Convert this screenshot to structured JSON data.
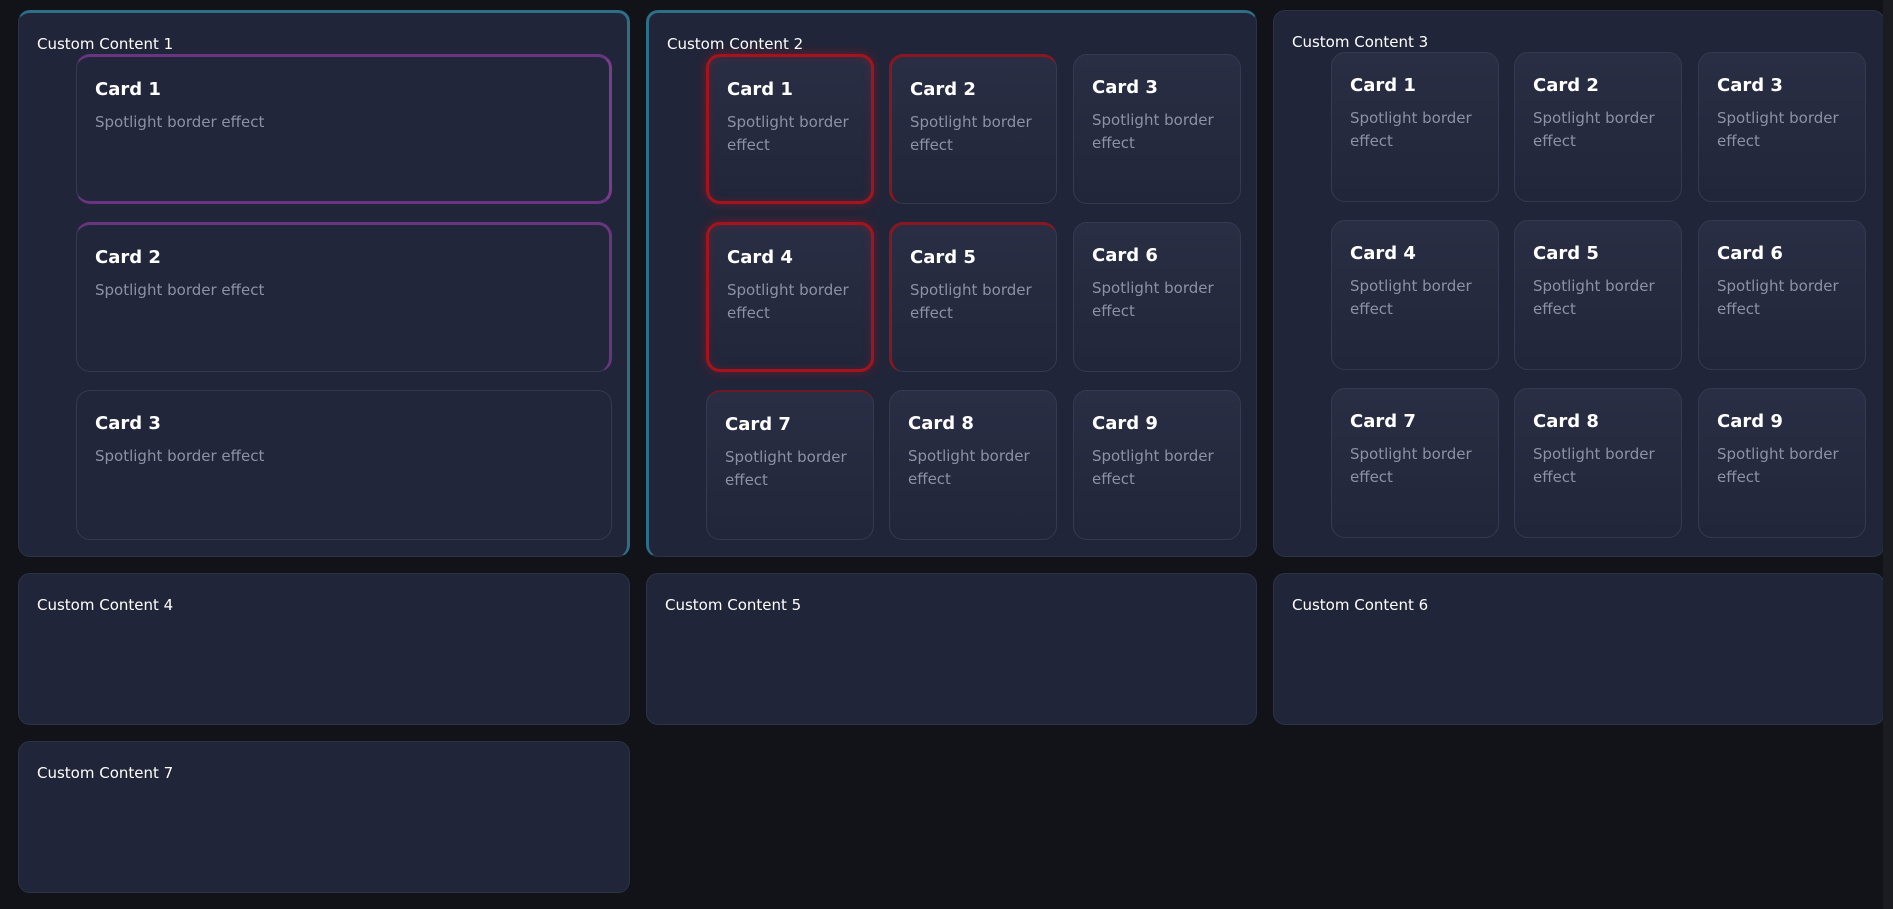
{
  "panels": [
    {
      "title": "Custom Content 1"
    },
    {
      "title": "Custom Content 2"
    },
    {
      "title": "Custom Content 3"
    },
    {
      "title": "Custom Content 4"
    },
    {
      "title": "Custom Content 5"
    },
    {
      "title": "Custom Content 6"
    },
    {
      "title": "Custom Content 7"
    }
  ],
  "panel1_cards": [
    {
      "title": "Card 1",
      "desc": "Spotlight border effect"
    },
    {
      "title": "Card 2",
      "desc": "Spotlight border effect"
    },
    {
      "title": "Card 3",
      "desc": "Spotlight border effect"
    }
  ],
  "panel2_cards": [
    {
      "title": "Card 1",
      "desc": "Spotlight border effect"
    },
    {
      "title": "Card 2",
      "desc": "Spotlight border effect"
    },
    {
      "title": "Card 3",
      "desc": "Spotlight border effect"
    },
    {
      "title": "Card 4",
      "desc": "Spotlight border effect"
    },
    {
      "title": "Card 5",
      "desc": "Spotlight border effect"
    },
    {
      "title": "Card 6",
      "desc": "Spotlight border effect"
    },
    {
      "title": "Card 7",
      "desc": "Spotlight border effect"
    },
    {
      "title": "Card 8",
      "desc": "Spotlight border effect"
    },
    {
      "title": "Card 9",
      "desc": "Spotlight border effect"
    }
  ],
  "panel3_cards": [
    {
      "title": "Card 1",
      "desc": "Spotlight border effect"
    },
    {
      "title": "Card 2",
      "desc": "Spotlight border effect"
    },
    {
      "title": "Card 3",
      "desc": "Spotlight border effect"
    },
    {
      "title": "Card 4",
      "desc": "Spotlight border effect"
    },
    {
      "title": "Card 5",
      "desc": "Spotlight border effect"
    },
    {
      "title": "Card 6",
      "desc": "Spotlight border effect"
    },
    {
      "title": "Card 7",
      "desc": "Spotlight border effect"
    },
    {
      "title": "Card 8",
      "desc": "Spotlight border effect"
    },
    {
      "title": "Card 9",
      "desc": "Spotlight border effect"
    }
  ],
  "colors": {
    "background": "#111318",
    "panel": "#212539",
    "card": "#2a2e44",
    "spotlight_red": "#a5141c",
    "spotlight_purple": "#7a3a8e",
    "spotlight_teal": "#2c6f86",
    "text": "#ffffff",
    "muted_text": "#8c91a3"
  }
}
